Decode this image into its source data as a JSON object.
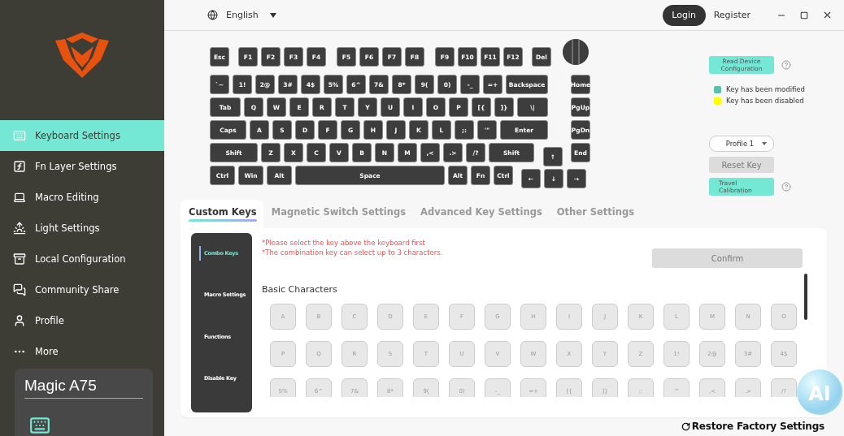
{
  "sidebar": {
    "items": [
      {
        "label": "Keyboard Settings",
        "selected": true
      },
      {
        "label": "Fn Layer Settings",
        "selected": false
      },
      {
        "label": "Macro Editing",
        "selected": false
      },
      {
        "label": "Light Settings",
        "selected": false
      },
      {
        "label": "Local Configuration",
        "selected": false
      },
      {
        "label": "Community Share",
        "selected": false
      },
      {
        "label": "Profile",
        "selected": false
      },
      {
        "label": "More",
        "selected": false
      }
    ],
    "device": {
      "name": "Magic A75"
    }
  },
  "topbar": {
    "language": "English",
    "login": "Login",
    "register": "Register"
  },
  "keyboard": {
    "rows": [
      {
        "keys": [
          "Esc",
          "F1",
          "F2",
          "F3",
          "F4",
          "F5",
          "F6",
          "F7",
          "F8",
          "F9",
          "F10",
          "F11",
          "F12",
          "Del"
        ]
      },
      {
        "keys": [
          "`~",
          "1!",
          "2@",
          "3#",
          "4$",
          "5%",
          "6^",
          "7&",
          "8*",
          "9(",
          "0)",
          "-_",
          "=+",
          "Backspace",
          "Home"
        ]
      },
      {
        "keys": [
          "Tab",
          "Q",
          "W",
          "E",
          "R",
          "T",
          "Y",
          "U",
          "I",
          "O",
          "P",
          "[{",
          "]}",
          "\\|",
          "PgUp"
        ]
      },
      {
        "keys": [
          "Caps",
          "A",
          "S",
          "D",
          "F",
          "G",
          "H",
          "J",
          "K",
          "L",
          ";:",
          "'\"",
          "Enter",
          "PgDn"
        ]
      },
      {
        "keys": [
          "Shift",
          "Z",
          "X",
          "C",
          "V",
          "B",
          "N",
          "M",
          ",<",
          ".>",
          "/?",
          "Shift",
          "↑",
          "End"
        ]
      },
      {
        "keys": [
          "Ctrl",
          "Win",
          "Alt",
          "Space",
          "Alt",
          "Fn",
          "Ctrl",
          "←",
          "↓",
          "→"
        ]
      }
    ]
  },
  "side_panel": {
    "read_config": {
      "label": "Read Device Configuration",
      "disabled": false
    },
    "legend": [
      {
        "label": "Key has been modified",
        "color": "#5bbfae"
      },
      {
        "label": "Key has been disabled",
        "color": "#ffff00"
      }
    ],
    "profile": "Profile 1",
    "reset": {
      "label": "Reset Key",
      "disabled": true
    },
    "calibration": {
      "label": "Travel Calibration",
      "disabled": false
    }
  },
  "tabs": [
    {
      "label": "Custom Keys",
      "selected": true
    },
    {
      "label": "Magnetic Switch Settings",
      "selected": false
    },
    {
      "label": "Advanced Key Settings",
      "selected": false
    },
    {
      "label": "Other Settings",
      "selected": false
    }
  ],
  "custom_keys": {
    "menu": [
      {
        "label": "Combo Keys",
        "selected": true
      },
      {
        "label": "Macro Settings",
        "selected": false
      },
      {
        "label": "Functions",
        "selected": false
      },
      {
        "label": "Disable Key",
        "selected": false
      }
    ],
    "notes": [
      "*Please select the key above the keyboard first",
      "*The combination key can select up to 3 characters."
    ],
    "confirm": {
      "label": "Confirm",
      "disabled": true
    },
    "section": "Basic Characters",
    "characters": [
      "A",
      "B",
      "C",
      "D",
      "E",
      "F",
      "G",
      "H",
      "I",
      "J",
      "K",
      "L",
      "M",
      "N",
      "O",
      "P",
      "Q",
      "R",
      "S",
      "T",
      "U",
      "V",
      "W",
      "X",
      "Y",
      "Z",
      "1!",
      "2@",
      "3#",
      "4$",
      "5%",
      "6^",
      "7&",
      "8*",
      "9(",
      "0)",
      "-_",
      "=+",
      "[{",
      "]}",
      ";:",
      "'\"",
      ",<",
      ".>",
      "/?"
    ]
  },
  "ai_button": "AI",
  "restore": "Restore Factory Settings"
}
